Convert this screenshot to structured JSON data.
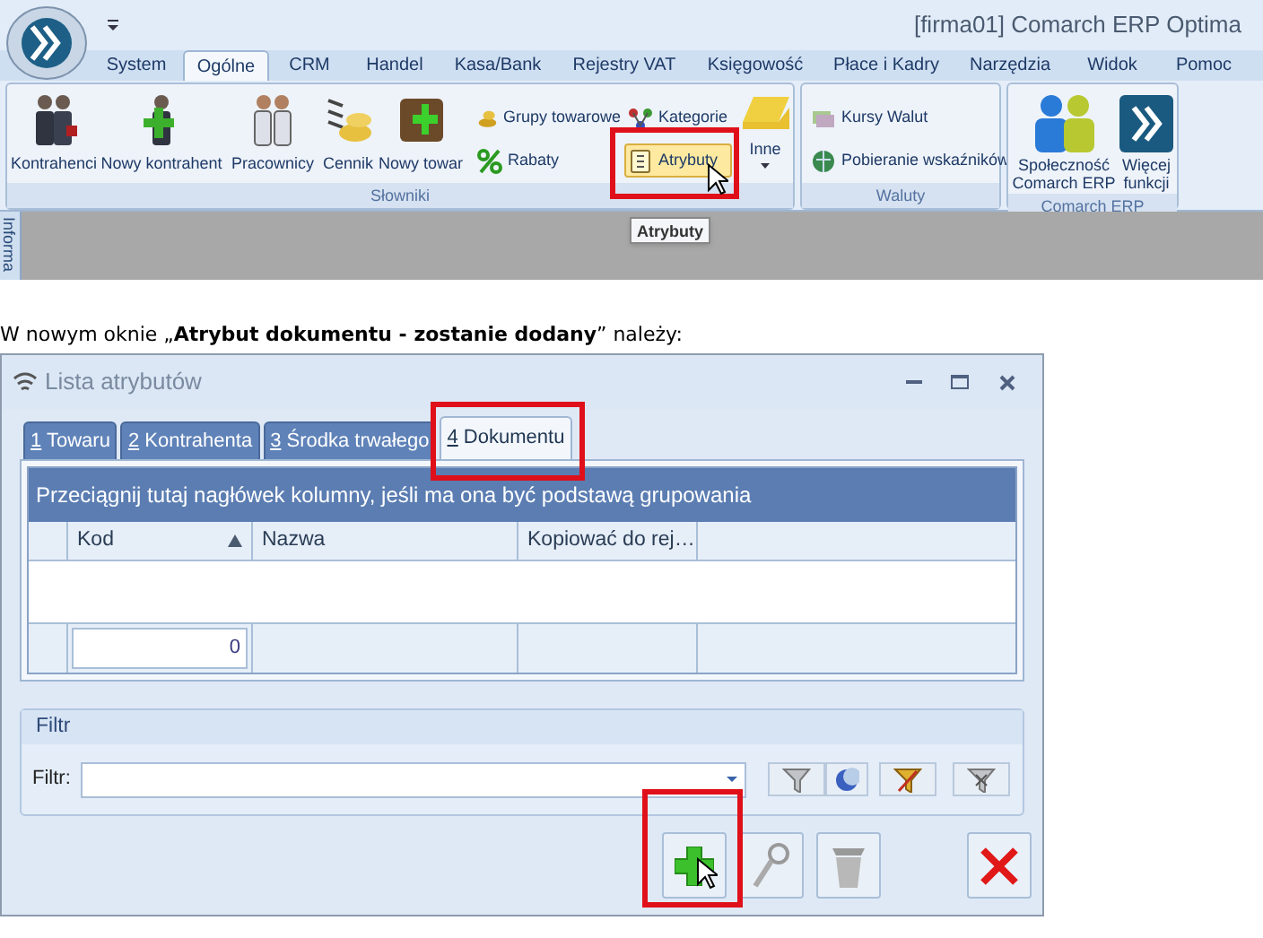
{
  "app": {
    "title": "[firma01] Comarch ERP Optima",
    "menu_tabs": [
      {
        "label": "System",
        "selected": false
      },
      {
        "label": "Ogólne",
        "selected": true
      },
      {
        "label": "CRM",
        "selected": false
      },
      {
        "label": "Handel",
        "selected": false
      },
      {
        "label": "Kasa/Bank",
        "selected": false
      },
      {
        "label": "Rejestry VAT",
        "selected": false
      },
      {
        "label": "Księgowość",
        "selected": false
      },
      {
        "label": "Płace i Kadry",
        "selected": false
      },
      {
        "label": "Narzędzia",
        "selected": false
      },
      {
        "label": "Widok",
        "selected": false
      },
      {
        "label": "Pomoc",
        "selected": false
      }
    ],
    "ribbon_groups": [
      {
        "label": "Słowniki",
        "buttons": [
          {
            "label": "Kontrahenci",
            "highlighted": false
          },
          {
            "label": "Nowy kontrahent",
            "highlighted": false
          },
          {
            "label": "Pracownicy",
            "highlighted": false
          },
          {
            "label": "Cennik",
            "highlighted": false
          },
          {
            "label": "Nowy towar",
            "highlighted": false
          },
          {
            "label": "Grupy towarowe",
            "highlighted": false
          },
          {
            "label": "Rabaty",
            "highlighted": false
          },
          {
            "label": "Kategorie",
            "highlighted": false
          },
          {
            "label": "Atrybuty",
            "highlighted": true
          },
          {
            "label": "Inne",
            "highlighted": false
          }
        ]
      },
      {
        "label": "Waluty",
        "buttons": [
          {
            "label": "Kursy Walut",
            "highlighted": false
          },
          {
            "label": "Pobieranie wskaźników",
            "highlighted": false
          }
        ]
      },
      {
        "label": "Comarch ERP",
        "buttons": [
          {
            "label": "Społeczność Comarch ERP",
            "highlighted": false
          },
          {
            "label": "Więcej funkcji",
            "highlighted": false
          }
        ]
      }
    ],
    "tooltip": "Atrybuty",
    "side_tab": "Informa"
  },
  "instruction": "W nowym oknie „**Atrybut dokumentu - zostanie dodany**” należy:",
  "dialog": {
    "title": "Lista atrybutów",
    "tabs": [
      {
        "key": "1",
        "label": "Towaru",
        "selected": false
      },
      {
        "key": "2",
        "label": "Kontrahenta",
        "selected": false
      },
      {
        "key": "3",
        "label": "Środka trwałego",
        "selected": false
      },
      {
        "key": "4",
        "label": "Dokumentu",
        "selected": true
      }
    ],
    "group_hint": "Przeciągnij tutaj nagłówek kolumny, jeśli ma ona być podstawą grupowania",
    "columns": [
      {
        "label": "Kod",
        "sorted": true
      },
      {
        "label": "Nazwa",
        "sorted": false
      },
      {
        "label": "Kopiować do rej…",
        "sorted": false
      }
    ],
    "footer_value": "0",
    "filter": {
      "section": "Filtr",
      "label": "Filtr:"
    }
  }
}
